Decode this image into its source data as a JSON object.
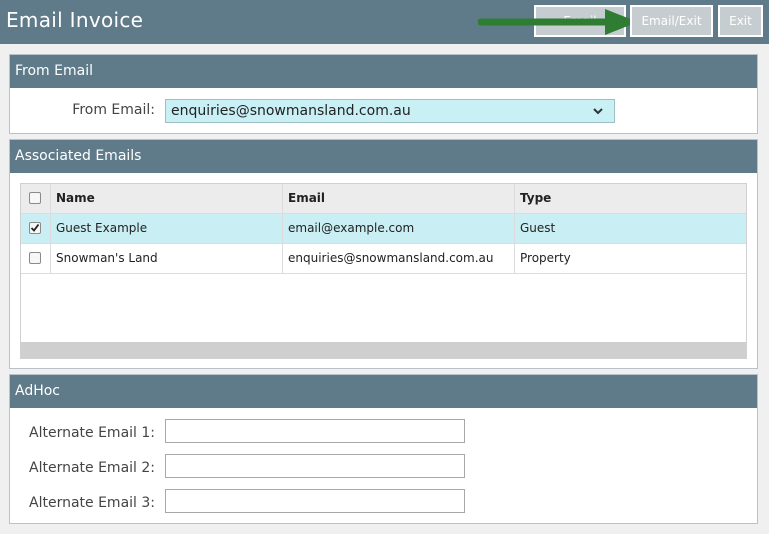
{
  "header": {
    "title": "Email Invoice",
    "buttons": {
      "email": "Email",
      "email_exit": "Email/Exit",
      "exit": "Exit"
    }
  },
  "from_email": {
    "section_title": "From Email",
    "label": "From Email:",
    "selected_value": "enquiries@snowmansland.com.au"
  },
  "associated_emails": {
    "section_title": "Associated Emails",
    "columns": [
      "Name",
      "Email",
      "Type"
    ],
    "rows": [
      {
        "checked": true,
        "name": "Guest Example",
        "email": "email@example.com",
        "type": "Guest"
      },
      {
        "checked": false,
        "name": "Snowman's Land",
        "email": "enquiries@snowmansland.com.au",
        "type": "Property"
      }
    ]
  },
  "adhoc": {
    "section_title": "AdHoc",
    "fields": [
      {
        "label": "Alternate Email 1:",
        "value": ""
      },
      {
        "label": "Alternate Email 2:",
        "value": ""
      },
      {
        "label": "Alternate Email 3:",
        "value": ""
      }
    ]
  },
  "colors": {
    "header_bg": "#5f7a89",
    "selected_row": "#c9eef3",
    "arrow": "#2e7d32"
  },
  "icons": {
    "dropdown": "chevron-down-icon",
    "arrow": "arrow-right-icon",
    "check": "checkmark-icon"
  }
}
